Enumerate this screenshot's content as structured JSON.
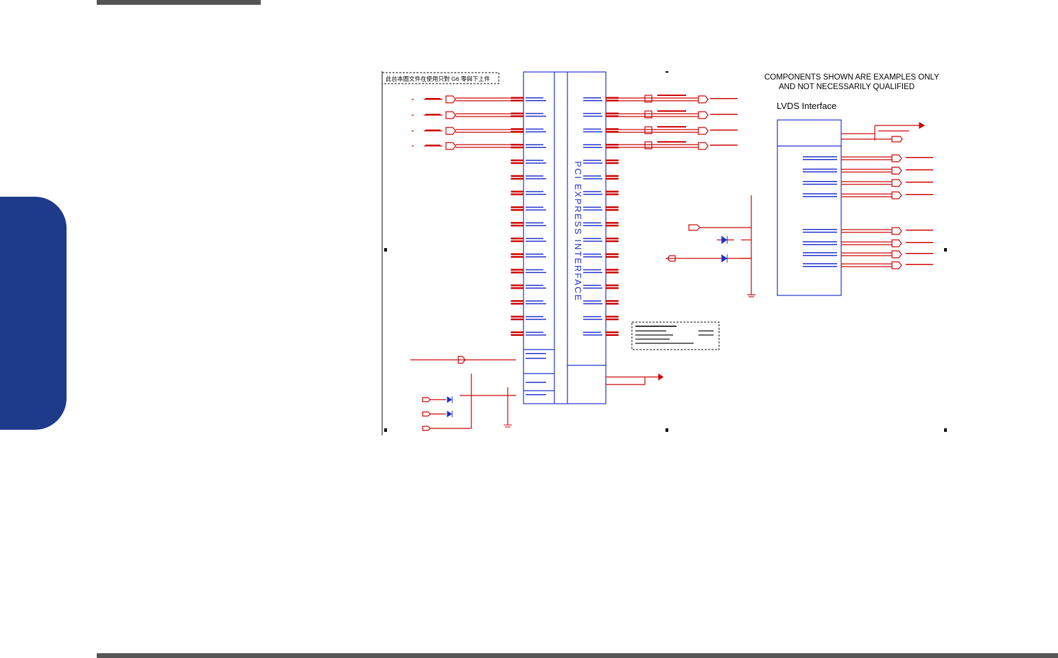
{
  "page": {
    "chapter_tab_color": "#1e3a8a",
    "bar_color": "#555555"
  },
  "schematic": {
    "title_note": "COMPONENTS SHOWN ARE EXAMPLES ONLY",
    "title_note_line2": "AND NOT NECESSARILY QUALIFIED",
    "lvds_title": "LVDS Interface",
    "pci_label": "PCI EXPRESS INTERFACE",
    "chinese_note": "此台本圖文件在使用只對 G6 零與下上件",
    "colors": {
      "wire_red": "#cc0000",
      "block_blue": "#1f2fcc",
      "text_green": "#22aa22"
    }
  }
}
